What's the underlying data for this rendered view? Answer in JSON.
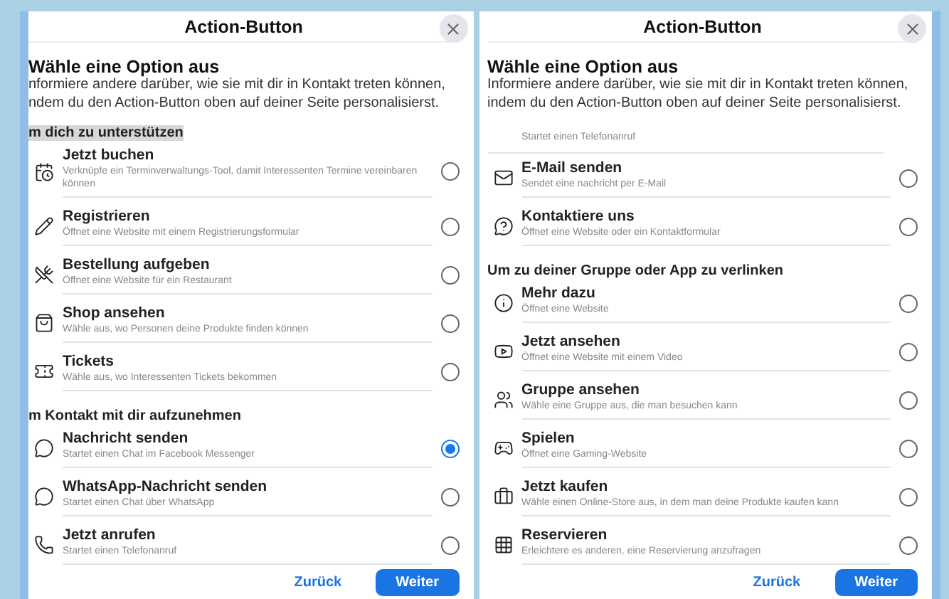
{
  "panels": [
    {
      "title": "Action-Button",
      "heading": "Wähle eine Option aus",
      "description": [
        "nformiere andere darüber, wie sie mit dir in Kontakt treten können,",
        "ndem du den Action-Button oben auf deiner Seite personalisierst."
      ],
      "items": [
        {
          "kind": "section",
          "label": "m dich zu unterstützen",
          "highlighted": true
        },
        {
          "kind": "option",
          "title": "Jetzt buchen",
          "subtitle": "Verknüpfe ein Terminverwaltungs-Tool, damit Interessenten Termine vereinbaren können",
          "selected": false
        },
        {
          "kind": "option",
          "title": "Registrieren",
          "subtitle": "Öffnet eine Website mit einem Registrierungsformular",
          "selected": false
        },
        {
          "kind": "option",
          "title": "Bestellung aufgeben",
          "subtitle": "Öffnet eine Website für ein Restaurant",
          "selected": false
        },
        {
          "kind": "option",
          "title": "Shop ansehen",
          "subtitle": "Wähle aus, wo Personen deine Produkte finden können",
          "selected": false
        },
        {
          "kind": "option",
          "title": "Tickets",
          "subtitle": "Wähle aus, wo Interessenten Tickets bekommen",
          "selected": false
        },
        {
          "kind": "section",
          "label": "m Kontakt mit dir aufzunehmen",
          "highlighted": false
        },
        {
          "kind": "option",
          "title": "Nachricht senden",
          "subtitle": "Startet einen Chat im Facebook Messenger",
          "selected": true
        },
        {
          "kind": "option",
          "title": "WhatsApp-Nachricht senden",
          "subtitle": "Startet einen Chat über WhatsApp",
          "selected": false
        },
        {
          "kind": "option",
          "title": "Jetzt anrufen",
          "subtitle": "Startet einen Telefonanruf",
          "selected": false
        }
      ],
      "buttons": [
        "Zurück",
        "Weiter"
      ]
    },
    {
      "title": "Action-Button",
      "heading": "Wähle eine Option aus",
      "description": [
        "Informiere andere darüber, wie sie mit dir in Kontakt treten können,",
        "indem du den Action-Button oben auf deiner Seite personalisierst."
      ],
      "items": [
        {
          "kind": "fragment",
          "subtitle": "Startet einen Telefonanruf"
        },
        {
          "kind": "option",
          "title": "E-Mail senden",
          "subtitle": "Sendet eine nachricht per E-Mail",
          "selected": false
        },
        {
          "kind": "option",
          "title": "Kontaktiere uns",
          "subtitle": "Öffnet eine Website oder ein Kontaktformular",
          "selected": false
        },
        {
          "kind": "section",
          "label": "Um zu deiner Gruppe oder App zu verlinken",
          "highlighted": false
        },
        {
          "kind": "option",
          "title": "Mehr dazu",
          "subtitle": "Öffnet eine Website",
          "selected": false
        },
        {
          "kind": "option",
          "title": "Jetzt ansehen",
          "subtitle": "Öffnet eine Website mit einem Video",
          "selected": false
        },
        {
          "kind": "option",
          "title": "Gruppe ansehen",
          "subtitle": "Wähle eine Gruppe aus, die man besuchen kann",
          "selected": false
        },
        {
          "kind": "option",
          "title": "Spielen",
          "subtitle": "Öffnet eine Gaming-Website",
          "selected": false
        },
        {
          "kind": "option",
          "title": "Jetzt kaufen",
          "subtitle": "Wähle einen Online-Store aus, in dem man deine Produkte kaufen kann",
          "selected": false
        },
        {
          "kind": "option",
          "title": "Reservieren",
          "subtitle": "Erleichtere es anderen, eine Reservierung anzufragen",
          "selected": false
        }
      ],
      "buttons": [
        "Zurück",
        "Weiter"
      ]
    }
  ]
}
